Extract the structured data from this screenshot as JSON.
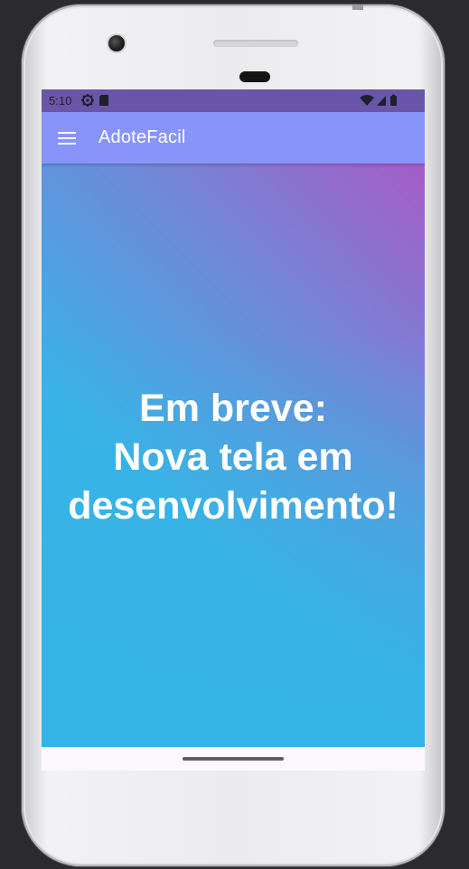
{
  "status_bar": {
    "time": "5:10",
    "left_icons": [
      "settings-gear-icon",
      "sd-card-icon"
    ],
    "right_icons": [
      "wifi-icon",
      "cell-signal-icon",
      "battery-icon"
    ]
  },
  "app_bar": {
    "menu_icon": "hamburger-menu-icon",
    "title": "AdoteFacil",
    "color": "#8894f9"
  },
  "content": {
    "message_lines": [
      "Em breve:",
      "Nova tela em",
      "desenvolvimento!"
    ],
    "gradient_colors": [
      "#a65cc8",
      "#33b4e4"
    ]
  },
  "navigation": {
    "home_indicator": "home-gesture-pill"
  }
}
